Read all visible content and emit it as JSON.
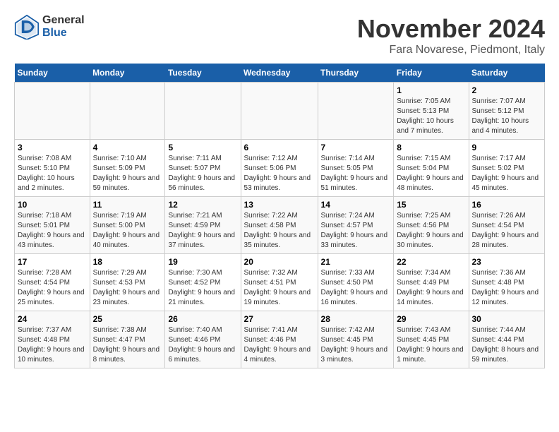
{
  "header": {
    "logo_line1": "General",
    "logo_line2": "Blue",
    "month": "November 2024",
    "location": "Fara Novarese, Piedmont, Italy"
  },
  "days_of_week": [
    "Sunday",
    "Monday",
    "Tuesday",
    "Wednesday",
    "Thursday",
    "Friday",
    "Saturday"
  ],
  "weeks": [
    [
      {
        "day": "",
        "info": ""
      },
      {
        "day": "",
        "info": ""
      },
      {
        "day": "",
        "info": ""
      },
      {
        "day": "",
        "info": ""
      },
      {
        "day": "",
        "info": ""
      },
      {
        "day": "1",
        "info": "Sunrise: 7:05 AM\nSunset: 5:13 PM\nDaylight: 10 hours and 7 minutes."
      },
      {
        "day": "2",
        "info": "Sunrise: 7:07 AM\nSunset: 5:12 PM\nDaylight: 10 hours and 4 minutes."
      }
    ],
    [
      {
        "day": "3",
        "info": "Sunrise: 7:08 AM\nSunset: 5:10 PM\nDaylight: 10 hours and 2 minutes."
      },
      {
        "day": "4",
        "info": "Sunrise: 7:10 AM\nSunset: 5:09 PM\nDaylight: 9 hours and 59 minutes."
      },
      {
        "day": "5",
        "info": "Sunrise: 7:11 AM\nSunset: 5:07 PM\nDaylight: 9 hours and 56 minutes."
      },
      {
        "day": "6",
        "info": "Sunrise: 7:12 AM\nSunset: 5:06 PM\nDaylight: 9 hours and 53 minutes."
      },
      {
        "day": "7",
        "info": "Sunrise: 7:14 AM\nSunset: 5:05 PM\nDaylight: 9 hours and 51 minutes."
      },
      {
        "day": "8",
        "info": "Sunrise: 7:15 AM\nSunset: 5:04 PM\nDaylight: 9 hours and 48 minutes."
      },
      {
        "day": "9",
        "info": "Sunrise: 7:17 AM\nSunset: 5:02 PM\nDaylight: 9 hours and 45 minutes."
      }
    ],
    [
      {
        "day": "10",
        "info": "Sunrise: 7:18 AM\nSunset: 5:01 PM\nDaylight: 9 hours and 43 minutes."
      },
      {
        "day": "11",
        "info": "Sunrise: 7:19 AM\nSunset: 5:00 PM\nDaylight: 9 hours and 40 minutes."
      },
      {
        "day": "12",
        "info": "Sunrise: 7:21 AM\nSunset: 4:59 PM\nDaylight: 9 hours and 37 minutes."
      },
      {
        "day": "13",
        "info": "Sunrise: 7:22 AM\nSunset: 4:58 PM\nDaylight: 9 hours and 35 minutes."
      },
      {
        "day": "14",
        "info": "Sunrise: 7:24 AM\nSunset: 4:57 PM\nDaylight: 9 hours and 33 minutes."
      },
      {
        "day": "15",
        "info": "Sunrise: 7:25 AM\nSunset: 4:56 PM\nDaylight: 9 hours and 30 minutes."
      },
      {
        "day": "16",
        "info": "Sunrise: 7:26 AM\nSunset: 4:54 PM\nDaylight: 9 hours and 28 minutes."
      }
    ],
    [
      {
        "day": "17",
        "info": "Sunrise: 7:28 AM\nSunset: 4:54 PM\nDaylight: 9 hours and 25 minutes."
      },
      {
        "day": "18",
        "info": "Sunrise: 7:29 AM\nSunset: 4:53 PM\nDaylight: 9 hours and 23 minutes."
      },
      {
        "day": "19",
        "info": "Sunrise: 7:30 AM\nSunset: 4:52 PM\nDaylight: 9 hours and 21 minutes."
      },
      {
        "day": "20",
        "info": "Sunrise: 7:32 AM\nSunset: 4:51 PM\nDaylight: 9 hours and 19 minutes."
      },
      {
        "day": "21",
        "info": "Sunrise: 7:33 AM\nSunset: 4:50 PM\nDaylight: 9 hours and 16 minutes."
      },
      {
        "day": "22",
        "info": "Sunrise: 7:34 AM\nSunset: 4:49 PM\nDaylight: 9 hours and 14 minutes."
      },
      {
        "day": "23",
        "info": "Sunrise: 7:36 AM\nSunset: 4:48 PM\nDaylight: 9 hours and 12 minutes."
      }
    ],
    [
      {
        "day": "24",
        "info": "Sunrise: 7:37 AM\nSunset: 4:48 PM\nDaylight: 9 hours and 10 minutes."
      },
      {
        "day": "25",
        "info": "Sunrise: 7:38 AM\nSunset: 4:47 PM\nDaylight: 9 hours and 8 minutes."
      },
      {
        "day": "26",
        "info": "Sunrise: 7:40 AM\nSunset: 4:46 PM\nDaylight: 9 hours and 6 minutes."
      },
      {
        "day": "27",
        "info": "Sunrise: 7:41 AM\nSunset: 4:46 PM\nDaylight: 9 hours and 4 minutes."
      },
      {
        "day": "28",
        "info": "Sunrise: 7:42 AM\nSunset: 4:45 PM\nDaylight: 9 hours and 3 minutes."
      },
      {
        "day": "29",
        "info": "Sunrise: 7:43 AM\nSunset: 4:45 PM\nDaylight: 9 hours and 1 minute."
      },
      {
        "day": "30",
        "info": "Sunrise: 7:44 AM\nSunset: 4:44 PM\nDaylight: 8 hours and 59 minutes."
      }
    ]
  ]
}
